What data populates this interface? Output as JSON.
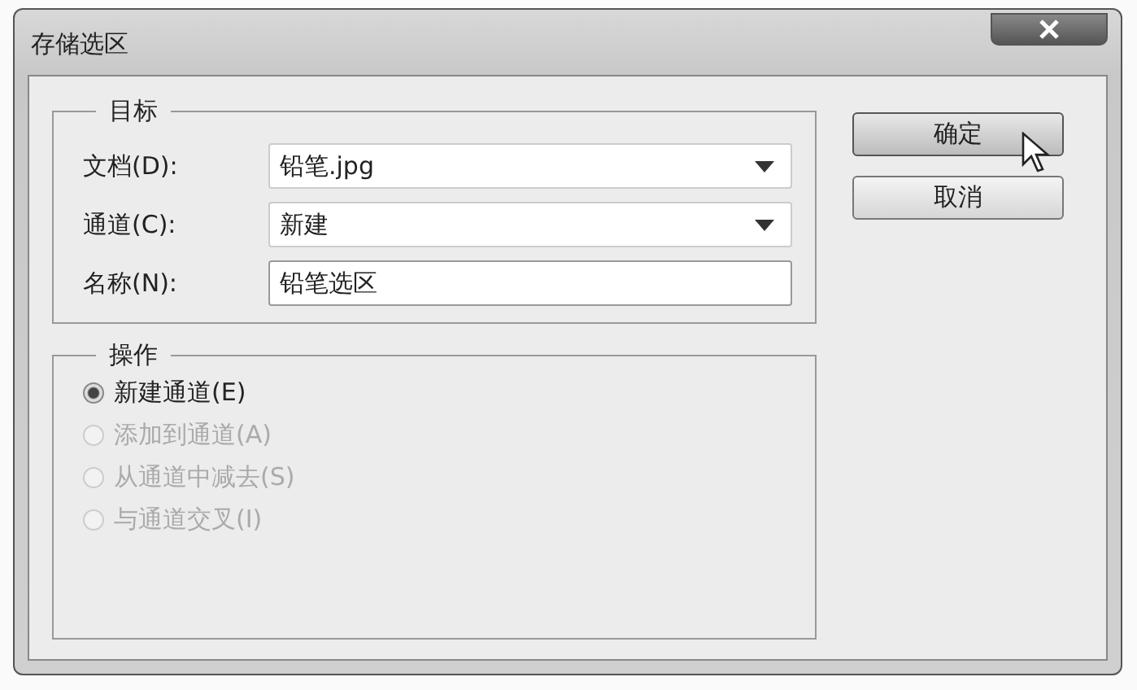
{
  "window": {
    "title": "存储选区"
  },
  "target_group": {
    "title": "目标",
    "fields": [
      {
        "label": "文档(D):",
        "value": "铅笔.jpg",
        "kind": "select"
      },
      {
        "label": "通道(C):",
        "value": "新建",
        "kind": "select"
      },
      {
        "label": "名称(N):",
        "value": "铅笔选区",
        "kind": "text"
      }
    ]
  },
  "operation_group": {
    "title": "操作",
    "options": [
      {
        "label": "新建通道(E)",
        "selected": true,
        "disabled": false
      },
      {
        "label": "添加到通道(A)",
        "selected": false,
        "disabled": true
      },
      {
        "label": "从通道中减去(S)",
        "selected": false,
        "disabled": true
      },
      {
        "label": "与通道交叉(I)",
        "selected": false,
        "disabled": true
      }
    ]
  },
  "buttons": [
    {
      "label": "确定",
      "hovered": true
    },
    {
      "label": "取消",
      "hovered": false
    }
  ]
}
